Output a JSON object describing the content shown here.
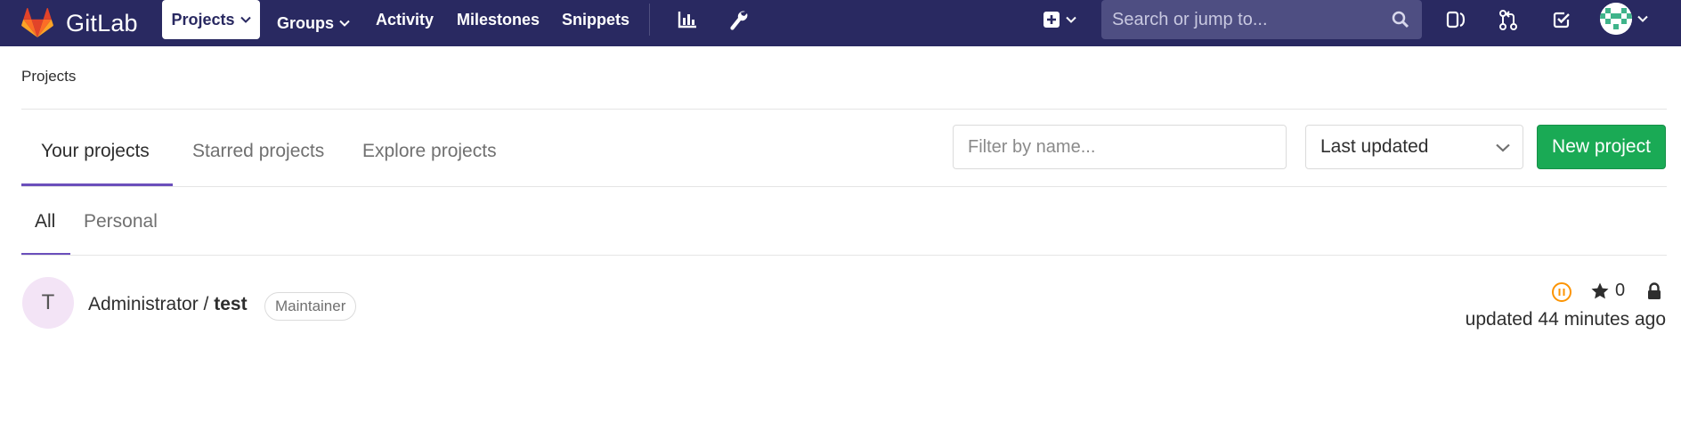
{
  "navbar": {
    "brand": "GitLab",
    "links": [
      {
        "label": "Projects",
        "active": true,
        "dropdown": true
      },
      {
        "label": "Groups",
        "active": false,
        "dropdown": true
      },
      {
        "label": "Activity",
        "active": false,
        "dropdown": false
      },
      {
        "label": "Milestones",
        "active": false,
        "dropdown": false
      },
      {
        "label": "Snippets",
        "active": false,
        "dropdown": false
      }
    ],
    "search_placeholder": "Search or jump to...",
    "icons": [
      "chart-icon",
      "wrench-icon",
      "plus-square-icon",
      "issues-icon",
      "merge-request-icon",
      "todo-icon"
    ],
    "colors": {
      "bg": "#292961",
      "search_bg": "#4e4e82"
    }
  },
  "breadcrumb": "Projects",
  "tabs": [
    {
      "label": "Your projects",
      "active": true
    },
    {
      "label": "Starred projects",
      "active": false
    },
    {
      "label": "Explore projects",
      "active": false
    }
  ],
  "filter": {
    "placeholder": "Filter by name..."
  },
  "sort": {
    "selected": "Last updated"
  },
  "new_project_label": "New project",
  "subtabs": [
    {
      "label": "All",
      "active": true
    },
    {
      "label": "Personal",
      "active": false
    }
  ],
  "projects": [
    {
      "avatar_letter": "T",
      "namespace": "Administrator / ",
      "name": "test",
      "role": "Maintainer",
      "stars": "0",
      "updated": "updated 44 minutes ago",
      "pipeline_status": "paused"
    }
  ],
  "accent": {
    "tab": "#6b4fbb",
    "button": "#1aaa55",
    "pipeline": "#fc9403"
  }
}
